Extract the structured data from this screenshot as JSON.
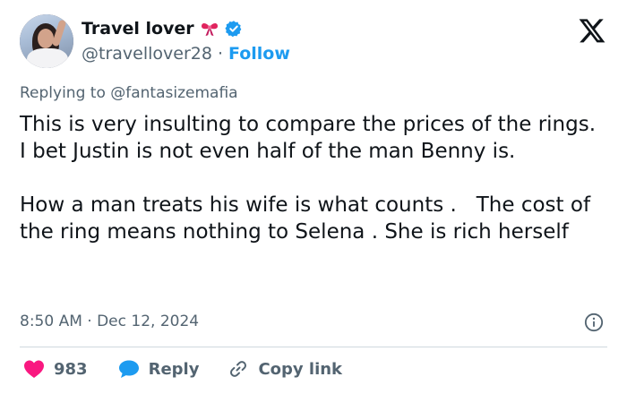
{
  "author": {
    "display_name": "Travel lover",
    "handle": "@travellover28",
    "separator": "·",
    "follow_label": "Follow",
    "bow_emoji": "bow-icon",
    "verified_color": "#1d9bf0"
  },
  "reply_prefix": "Replying to @fantasizemafia",
  "body": "This is very insulting to compare the prices of the rings.   I bet Justin is not even half of the man Benny is.\n\nHow a man treats his wife is what counts .   The cost of the ring means nothing to Selena . She is rich herself",
  "timestamp": "8:50 AM · Dec 12, 2024",
  "actions": {
    "like_count": "983",
    "reply_label": "Reply",
    "copy_label": "Copy link"
  },
  "colors": {
    "text": "#0f1419",
    "muted": "#536471",
    "link": "#1d9bf0",
    "like": "#f91880",
    "divider": "#cfd9de"
  }
}
